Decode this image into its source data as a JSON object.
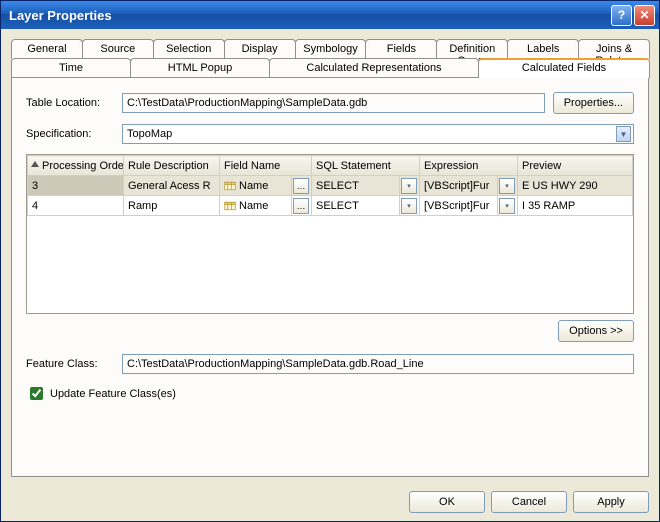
{
  "window": {
    "title": "Layer Properties"
  },
  "tabs": {
    "row1": [
      "General",
      "Source",
      "Selection",
      "Display",
      "Symbology",
      "Fields",
      "Definition Query",
      "Labels",
      "Joins & Relates"
    ],
    "row2": [
      "Time",
      "HTML Popup",
      "Calculated Representations",
      "Calculated Fields"
    ],
    "active": "Calculated Fields"
  },
  "form": {
    "table_location_label": "Table Location:",
    "table_location_value": "C:\\TestData\\ProductionMapping\\SampleData.gdb",
    "properties_btn": "Properties...",
    "specification_label": "Specification:",
    "specification_value": "TopoMap",
    "feature_class_label": "Feature Class:",
    "feature_class_value": "C:\\TestData\\ProductionMapping\\SampleData.gdb.Road_Line",
    "update_fc_label": "Update Feature Class(es)",
    "options_btn": "Options >>"
  },
  "grid": {
    "columns": [
      "Processing Order",
      "Rule Description",
      "Field Name",
      "SQL Statement",
      "Expression",
      "Preview"
    ],
    "rows": [
      {
        "order": "3",
        "rule": "General Acess R",
        "field": "Name",
        "sql": "SELECT <Targ",
        "expr": "[VBScript]Fur",
        "preview": "E US HWY 290",
        "selected": true
      },
      {
        "order": "4",
        "rule": "Ramp",
        "field": "Name",
        "sql": "SELECT <Targ",
        "expr": "[VBScript]Fur",
        "preview": "I 35 RAMP",
        "selected": false
      }
    ]
  },
  "buttons": {
    "ok": "OK",
    "cancel": "Cancel",
    "apply": "Apply"
  }
}
